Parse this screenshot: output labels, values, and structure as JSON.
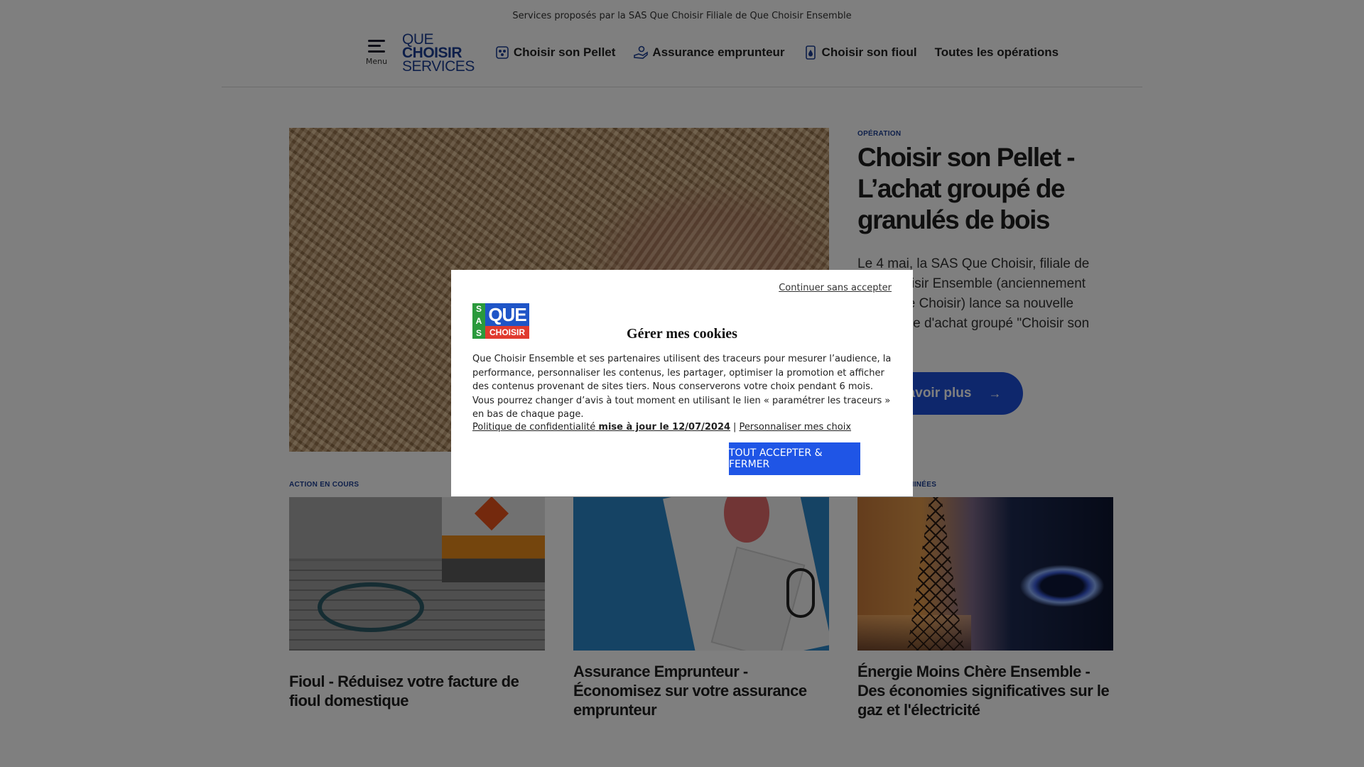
{
  "topbar": {
    "text": "Services proposés par la SAS Que Choisir Filiale de Que Choisir Ensemble"
  },
  "header": {
    "menu_label": "Menu",
    "logo_lines": [
      "QUE",
      "CHOISIR",
      "SERVICES"
    ],
    "nav": [
      {
        "label": "Choisir son Pellet",
        "icon": "pellet-icon"
      },
      {
        "label": "Assurance emprunteur",
        "icon": "hand-coin-icon"
      },
      {
        "label": "Choisir son fioul",
        "icon": "fuel-drop-icon"
      },
      {
        "label": "Toutes les opérations",
        "icon": ""
      }
    ]
  },
  "hero": {
    "eyebrow": "OPÉRATION",
    "title": "Choisir son Pellet - L’achat groupé de granulés de bois",
    "text": "Le 4 mai, la SAS Que Choisir, filiale de Que Choisir Ensemble (anciennement UFC-Que Choisir) lance sa nouvelle campagne d'achat groupé \"Choisir son",
    "button": "En savoir plus",
    "button_arrow": "→"
  },
  "cards": [
    {
      "eyebrow": "ACTION EN COURS",
      "title": "Fioul - Réduisez votre facture de fioul domestique"
    },
    {
      "eyebrow": "",
      "title": " Assurance Emprunteur - Économisez sur votre assurance emprunteur"
    },
    {
      "eyebrow": "ACTIONS TERMINÉES",
      "title": "Énergie Moins Chère Ensemble - Des économies significatives sur le gaz et l'électricité"
    }
  ],
  "cookie_modal": {
    "skip_link": "Continuer sans accepter",
    "logo": {
      "sas": [
        "S",
        "A",
        "S"
      ],
      "que": "QUE",
      "choisir": "CHOISIR"
    },
    "title": "Gérer mes cookies",
    "body": "Que Choisir Ensemble et ses partenaires utilisent des traceurs pour mesurer l’audience, la performance, personnaliser les contenus, les partager, optimiser la promotion et afficher des contenus provenant de sites tiers. Nous conserverons votre choix pendant 6 mois. Vous pourrez changer d’avis à tout moment en utilisant le lien « paramétrer les traceurs » en bas de chaque page.",
    "privacy_link": "Politique de confidentialité",
    "privacy_update": "mise à jour le 12/07/2024",
    "separator": "|",
    "customize_link": "Personnaliser mes choix",
    "accept_button": "TOUT ACCEPTER & FERMER"
  },
  "colors": {
    "brand_blue": "#1c3f94",
    "cta_blue": "#1d4ed8",
    "overlay": "rgba(0,0,0,0.5)"
  }
}
